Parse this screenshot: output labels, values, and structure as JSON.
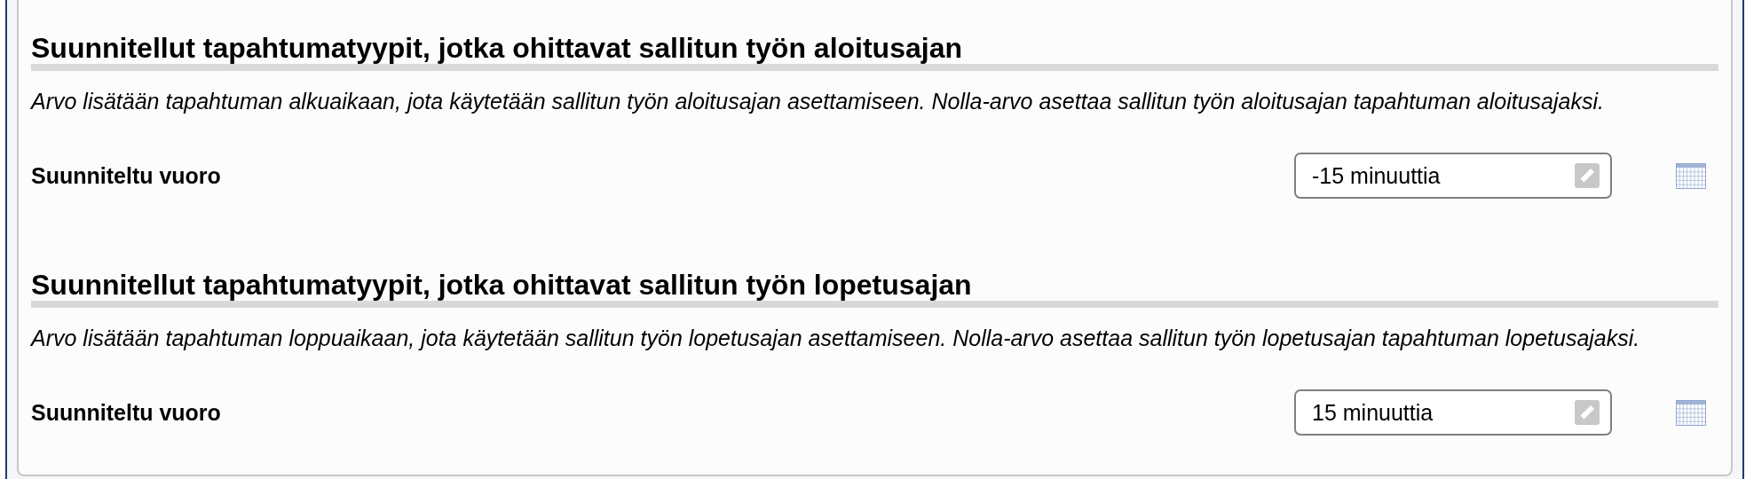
{
  "sections": [
    {
      "heading": "Suunnitellut tapahtumatyypit, jotka ohittavat sallitun työn aloitusajan",
      "description": "Arvo lisätään tapahtuman alkuaikaan, jota käytetään sallitun työn aloitusajan asettamiseen. Nolla-arvo asettaa sallitun työn aloitusajan tapahtuman aloitusajaksi.",
      "field": {
        "label": "Suunniteltu vuoro",
        "value": "-15 minuuttia"
      }
    },
    {
      "heading": "Suunnitellut tapahtumatyypit, jotka ohittavat sallitun työn lopetusajan",
      "description": "Arvo lisätään tapahtuman loppuaikaan, jota käytetään sallitun työn lopetusajan asettamiseen. Nolla-arvo asettaa sallitun työn lopetusajan tapahtuman lopetusajaksi.",
      "field": {
        "label": "Suunniteltu vuoro",
        "value": "15 minuuttia"
      }
    }
  ]
}
